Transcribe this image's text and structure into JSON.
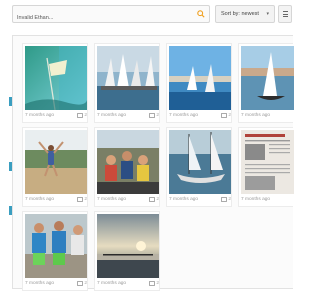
{
  "search": {
    "value": "Invalid Ethan..."
  },
  "sort": {
    "label": "Sort by: newest"
  },
  "sidebar_marks": 3,
  "cards": [
    {
      "age": "7 months ago",
      "count": "2"
    },
    {
      "age": "7 months ago",
      "count": "2"
    },
    {
      "age": "7 months ago",
      "count": "2"
    },
    {
      "age": "7 months ago",
      "count": "2"
    },
    {
      "age": "7 months ago",
      "count": "2"
    },
    {
      "age": "7 months ago",
      "count": "2"
    },
    {
      "age": "7 months ago",
      "count": "2"
    },
    {
      "age": "7 months ago",
      "count": "2"
    },
    {
      "age": "7 months ago",
      "count": "2"
    },
    {
      "age": "7 months ago",
      "count": "2"
    }
  ],
  "colors": {
    "accent": "#3a9ec0",
    "search_icon": "#f0a020"
  }
}
